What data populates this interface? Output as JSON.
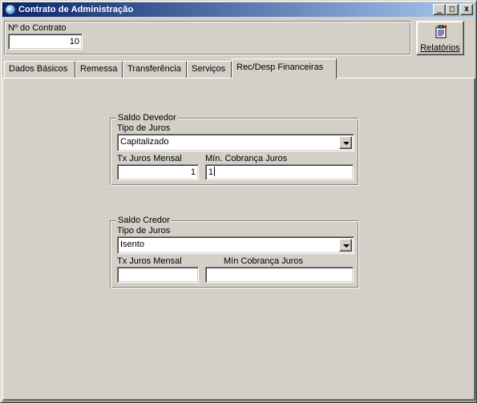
{
  "window": {
    "title": "Contrato de Administração",
    "controls": {
      "minimize": "_",
      "maximize": "□",
      "close": "x"
    }
  },
  "header": {
    "contract_label": "Nº do Contrato",
    "contract_value": "10",
    "reports_button": "Relatórios"
  },
  "tabs": [
    {
      "label": "Dados Básicos"
    },
    {
      "label": "Remessa"
    },
    {
      "label": "Transferência"
    },
    {
      "label": "Serviços"
    },
    {
      "label": "Rec/Desp Financeiras"
    }
  ],
  "saldo_devedor": {
    "legend": "Saldo Devedor",
    "tipo_juros_label": "Tipo de Juros",
    "tipo_juros_value": "Capitalizado",
    "tx_label": "Tx Juros Mensal",
    "tx_value": "1",
    "min_label": "Mín. Cobrança Juros",
    "min_value": "1"
  },
  "saldo_credor": {
    "legend": "Saldo Credor",
    "tipo_juros_label": "Tipo de Juros",
    "tipo_juros_value": "Isento",
    "tx_label": "Tx Juros Mensal",
    "tx_value": "",
    "min_label": "Mín Cobrança Juros",
    "min_value": ""
  },
  "icons": {
    "app": "app-globe-icon",
    "reports": "report-clipboard-icon",
    "dropdown": "chevron-down-icon"
  },
  "colors": {
    "titlebar_start": "#0a246a",
    "titlebar_end": "#a6caf0",
    "face": "#d4d0c8"
  }
}
